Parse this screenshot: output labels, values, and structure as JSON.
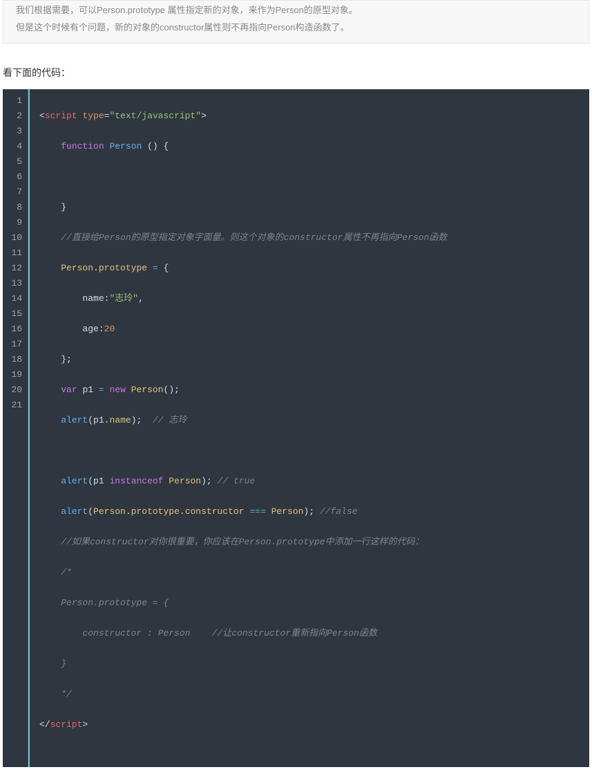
{
  "note": {
    "line1": "我们根据需要，可以Person.prototype 属性指定新的对象，来作为Person的原型对象。",
    "line2": "但是这个时候有个问题，新的对象的constructor属性则不再指向Person构造函数了。"
  },
  "heading": "看下面的代码：",
  "code": {
    "lang": "javascript",
    "line_numbers": [
      "1",
      "2",
      "3",
      "4",
      "5",
      "6",
      "7",
      "8",
      "9",
      "10",
      "11",
      "12",
      "13",
      "14",
      "15",
      "16",
      "17",
      "18",
      "19",
      "20",
      "21"
    ],
    "l1": {
      "open": "<",
      "tag": "script",
      "sp": " ",
      "attr": "type",
      "eq": "=",
      "val": "\"text/javascript\"",
      "close": ">"
    },
    "l2": {
      "indent": "    ",
      "kw": "function",
      "sp": " ",
      "name": "Person",
      "sp2": " ",
      "lp": "(",
      "rp": ")",
      "sp3": " ",
      "lb": "{"
    },
    "l3": {
      "blank": ""
    },
    "l4": {
      "indent": "    ",
      "rb": "}"
    },
    "l5": {
      "indent": "    ",
      "comment": "//直接给Person的原型指定对象字面量。则这个对象的constructor属性不再指向Person函数"
    },
    "l6": {
      "indent": "    ",
      "obj": "Person",
      "dot": ".",
      "prop": "prototype",
      "sp": " ",
      "eq": "=",
      "sp2": " ",
      "lb": "{"
    },
    "l7": {
      "indent": "        ",
      "key": "name",
      "colon": ":",
      "val": "\"志玲\"",
      "comma": ","
    },
    "l8": {
      "indent": "        ",
      "key": "age",
      "colon": ":",
      "val": "20"
    },
    "l9": {
      "indent": "    ",
      "rb": "}",
      "semi": ";"
    },
    "l10": {
      "indent": "    ",
      "kw": "var",
      "sp": " ",
      "id": "p1",
      "sp2": " ",
      "eq": "=",
      "sp3": " ",
      "newkw": "new",
      "sp4": " ",
      "ctor": "Person",
      "lp": "(",
      "rp": ")",
      "semi": ";"
    },
    "l11": {
      "indent": "    ",
      "fn": "alert",
      "lp": "(",
      "arg_obj": "p1",
      "dot": ".",
      "arg_prop": "name",
      "rp": ")",
      "semi": ";",
      "sp": "  ",
      "comment": "// 志玲"
    },
    "l12": {
      "blank": ""
    },
    "l13": {
      "indent": "    ",
      "fn": "alert",
      "lp": "(",
      "lhs": "p1",
      "sp": " ",
      "op": "instanceof",
      "sp2": " ",
      "rhs": "Person",
      "rp": ")",
      "semi": ";",
      "sp3": " ",
      "comment": "// true"
    },
    "l14": {
      "indent": "    ",
      "fn": "alert",
      "lp": "(",
      "o1": "Person",
      "d1": ".",
      "p1": "prototype",
      "d2": ".",
      "p2": "constructor",
      "sp": " ",
      "op": "===",
      "sp2": " ",
      "rhs": "Person",
      "rp": ")",
      "semi": ";",
      "sp3": " ",
      "comment": "//false"
    },
    "l15": {
      "indent": "    ",
      "comment": "//如果constructor对你很重要，你应该在Person.prototype中添加一行这样的代码："
    },
    "l16": {
      "indent": "    ",
      "comment": "/*"
    },
    "l17": {
      "indent": "    ",
      "comment": "Person.prototype = {"
    },
    "l18": {
      "indent": "        ",
      "comment": "constructor : Person    //让constructor重新指向Person函数"
    },
    "l19": {
      "indent": "    ",
      "comment": "}"
    },
    "l20": {
      "indent": "    ",
      "comment": "*/"
    },
    "l21": {
      "open": "</",
      "tag": "script",
      "close": ">"
    }
  }
}
